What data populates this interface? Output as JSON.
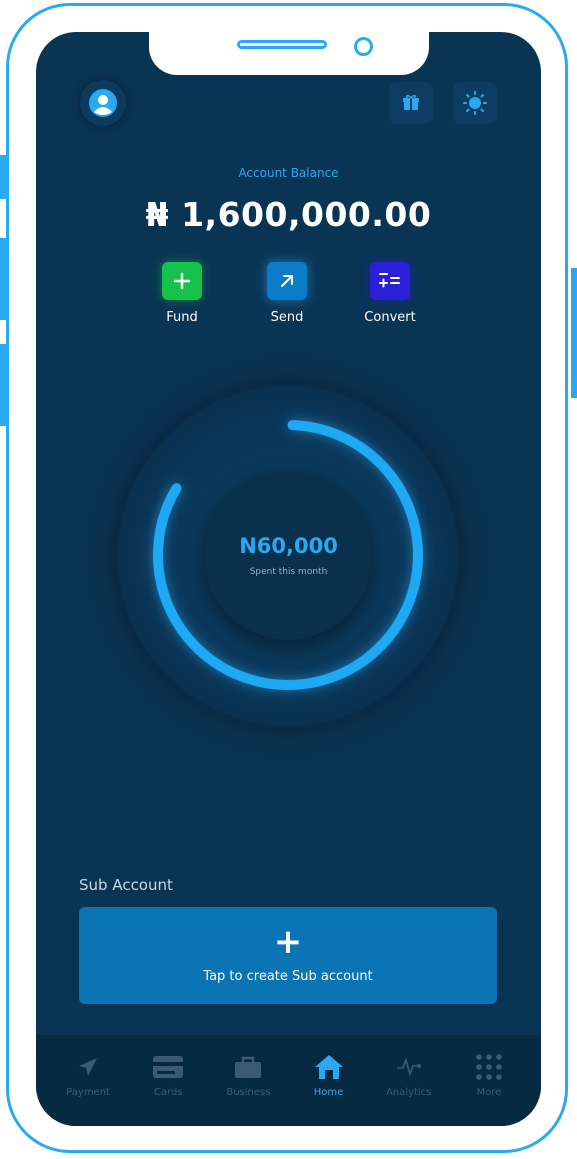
{
  "header": {
    "avatar": "user-avatar",
    "icons": [
      "gift-icon",
      "sun-icon"
    ]
  },
  "balance": {
    "label": "Account Balance",
    "amount": "₦ 1,600,000.00"
  },
  "actions": [
    {
      "label": "Fund",
      "icon": "plus-icon",
      "color": "#16c24a"
    },
    {
      "label": "Send",
      "icon": "arrow-up-right-icon",
      "color": "#0a7cc8"
    },
    {
      "label": "Convert",
      "icon": "convert-icon",
      "color": "#2a20d8"
    }
  ],
  "spending": {
    "amount": "N60,000",
    "label": "Spent this month",
    "progress": 0.83
  },
  "sub_account": {
    "title": "Sub Account",
    "plus": "+",
    "cta": "Tap to create Sub account"
  },
  "tabs": [
    {
      "label": "Payment",
      "icon": "send-icon",
      "active": false
    },
    {
      "label": "Cards",
      "icon": "card-icon",
      "active": false
    },
    {
      "label": "Business",
      "icon": "briefcase-icon",
      "active": false
    },
    {
      "label": "Home",
      "icon": "home-icon",
      "active": true
    },
    {
      "label": "Analytics",
      "icon": "pulse-icon",
      "active": false
    },
    {
      "label": "More",
      "icon": "grid-icon",
      "active": false
    }
  ],
  "colors": {
    "accent": "#2aa8f2",
    "background": "#0a3454",
    "card": "#0a74b5"
  }
}
